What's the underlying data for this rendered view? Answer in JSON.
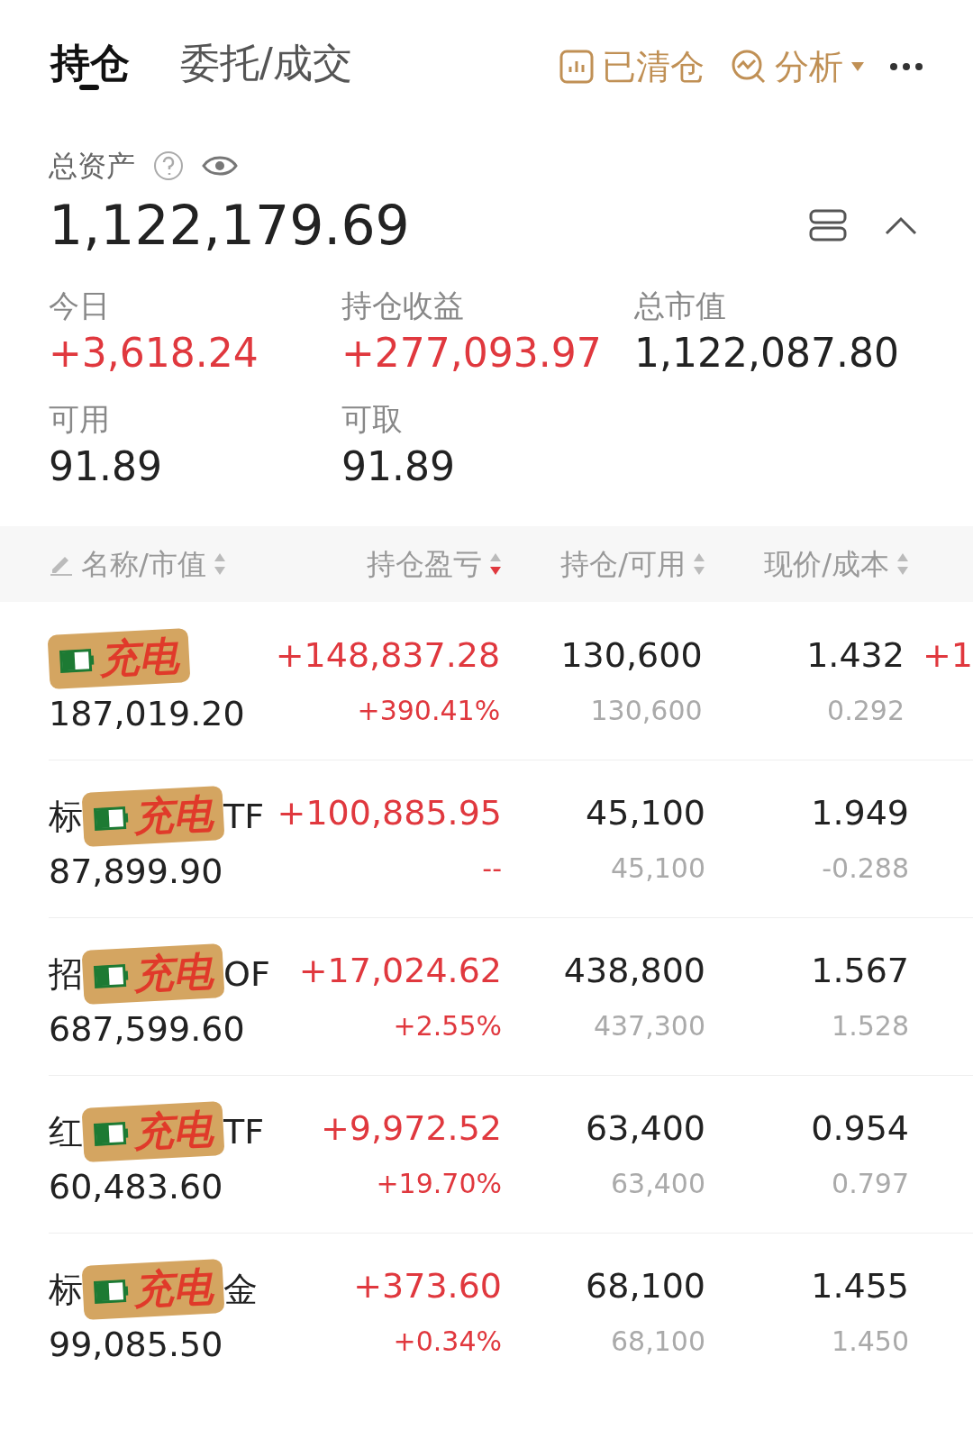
{
  "tabs": [
    {
      "label": "持仓",
      "selected": true
    },
    {
      "label": "委托/成交",
      "selected": false
    }
  ],
  "actions": [
    {
      "kind": "chart",
      "label": "已清仓"
    },
    {
      "kind": "analysis",
      "label": "分析"
    },
    {
      "kind": "more"
    }
  ],
  "summary": {
    "label": "总资产",
    "value": "1,122,179.69",
    "expanded": true,
    "stats": [
      {
        "label": "今日",
        "value": "+3,618.24",
        "positive": true
      },
      {
        "label": "持仓收益",
        "value": "+277,093.97",
        "positive": true
      },
      {
        "label": "总市值",
        "value": "1,122,087.80",
        "positive": false
      },
      {
        "label": "可用",
        "value": "91.89",
        "positive": false
      },
      {
        "label": "可取",
        "value": "91.89",
        "positive": false
      }
    ]
  },
  "table": {
    "columns": [
      {
        "label": "名称/市值",
        "sorted": false
      },
      {
        "label": "持仓盈亏",
        "sorted": true
      },
      {
        "label": "持仓/可用",
        "sorted": false
      },
      {
        "label": "现价/成本",
        "sorted": false
      }
    ],
    "rows": [
      {
        "name_start": "",
        "sticker": "充电",
        "name_end": "",
        "market_value": "187,019.20",
        "pnl": "+148,837.28",
        "pnl_pct": "+390.41%",
        "holding": "130,600",
        "available": "130,600",
        "price": "1.432",
        "cost": "0.292",
        "column_5": "+1"
      },
      {
        "name_start": "标",
        "sticker": "充电",
        "name_end": "TF",
        "market_value": "87,899.90",
        "pnl": "+100,885.95",
        "pnl_pct": "--",
        "holding": "45,100",
        "available": "45,100",
        "price": "1.949",
        "cost": "-0.288"
      },
      {
        "name_start": "招",
        "sticker": "充电",
        "name_end": "OF",
        "market_value": "687,599.60",
        "pnl": "+17,024.62",
        "pnl_pct": "+2.55%",
        "holding": "438,800",
        "available": "437,300",
        "price": "1.567",
        "cost": "1.528"
      },
      {
        "name_start": "红",
        "sticker": "充电",
        "name_end": "TF",
        "market_value": "60,483.60",
        "pnl": "+9,972.52",
        "pnl_pct": "+19.70%",
        "holding": "63,400",
        "available": "63,400",
        "price": "0.954",
        "cost": "0.797"
      },
      {
        "name_start": "标",
        "sticker": "充电",
        "name_end": "金",
        "market_value": "99,085.50",
        "pnl": "+373.60",
        "pnl_pct": "+0.34%",
        "holding": "68,100",
        "available": "68,100",
        "price": "1.455",
        "cost": "1.450"
      }
    ]
  }
}
